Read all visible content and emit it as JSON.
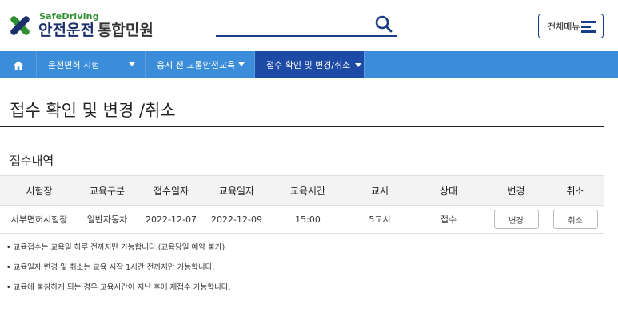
{
  "header": {
    "logo_small": "SafeDriving",
    "logo_main": "안전운전",
    "logo_sub": "통합민원",
    "menu_label": "전체메뉴"
  },
  "nav": {
    "items": [
      {
        "label": "운전면허 시험"
      },
      {
        "label": "응시 전 교통안전교육"
      },
      {
        "label": "접수 확인 및 변경/취소"
      }
    ]
  },
  "page": {
    "title": "접수 확인 및 변경 /취소",
    "section_title": "접수내역"
  },
  "table": {
    "headers": [
      "시험장",
      "교육구분",
      "접수일자",
      "교육일자",
      "교육시간",
      "교시",
      "상태",
      "변경",
      "취소"
    ],
    "rows": [
      {
        "site": "서부면허시험장",
        "type": "일반자동차",
        "apply_date": "2022-12-07",
        "edu_date": "2022-12-09",
        "edu_time": "15:00",
        "period": "5교시",
        "status": "접수",
        "change_label": "변경",
        "cancel_label": "취소"
      }
    ]
  },
  "notes": [
    "• 교육접수는 교육일 하루 전까지만 가능합니다.(교육당일 예약 불가)",
    "• 교육일자 변경 및 취소는 교육 시작 1시간 전까지만 가능합니다.",
    "• 교육에 불참하게 되는 경우 교육시간이 지난 후에 재접수 가능합니다."
  ],
  "colors": {
    "nav_bg": "#3b8cd9",
    "nav_active": "#1c4aa5",
    "brand_navy": "#1b2f6b",
    "brand_green": "#2f8f2f"
  }
}
